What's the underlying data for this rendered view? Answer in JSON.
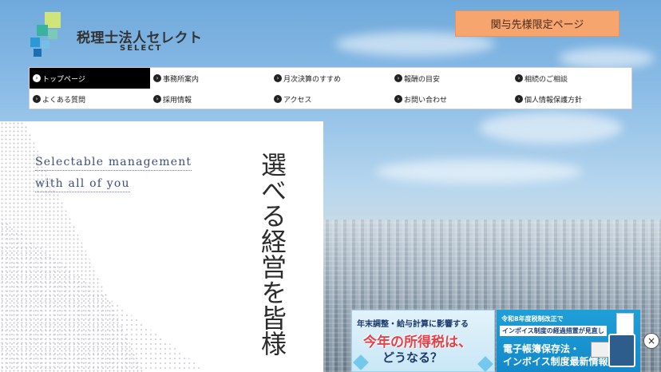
{
  "header": {
    "logo_title": "税理士法人セレクト",
    "logo_sub": "SELECT",
    "client_button": "関与先様限定ページ"
  },
  "nav": {
    "items": [
      {
        "label": "トップページ",
        "active": true
      },
      {
        "label": "事務所案内"
      },
      {
        "label": "月次決算のすすめ"
      },
      {
        "label": "報酬の目安"
      },
      {
        "label": "相続のご相談"
      },
      {
        "label": "よくある質問"
      },
      {
        "label": "採用情報"
      },
      {
        "label": "アクセス"
      },
      {
        "label": "お問い合わせ"
      },
      {
        "label": "個人情報保護方針"
      }
    ]
  },
  "hero": {
    "tagline_1": "Selectable management",
    "tagline_2": "with all of you",
    "vertical_text": "選べる経営を皆様"
  },
  "banners": {
    "b1_top": "年末調整・給与計算に影響する",
    "b1_mid": "今年の所得税は、",
    "b1_bot": "どうなる？",
    "b2_top": "令和8年度税制改正で",
    "b2_tag": "インボイス制度の経過措置が見直し",
    "b2_line1": "電子帳簿保存法・",
    "b2_line2": "インボイス制度最新情報"
  },
  "close_icon": "×",
  "colors": {
    "client_button_bg": "#f6a56f",
    "nav_active_bg": "#000000",
    "tagline": "#3b4e7a",
    "banner2_bg": "#1f9fd8"
  }
}
